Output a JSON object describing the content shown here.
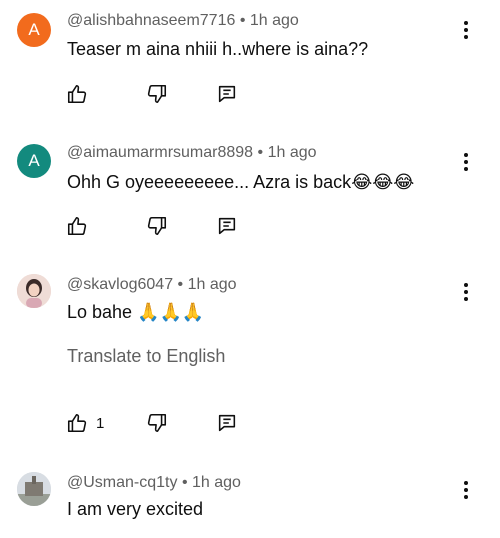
{
  "comments": [
    {
      "author": "@alishbahnaseem7716",
      "time": "1h ago",
      "avatar_letter": "A",
      "avatar_color": "#f26b1d",
      "text": "Teaser m aina nhiii h..where is aina??",
      "likes": ""
    },
    {
      "author": "@aimaumarmrsumar8898",
      "time": "1h ago",
      "avatar_letter": "A",
      "avatar_color": "#138a7e",
      "text": "Ohh G oyeeeeeeeee... Azra is back",
      "emoji": "😂😂😂",
      "likes": ""
    },
    {
      "author": "@skavlog6047",
      "time": "1h ago",
      "avatar_letter": "",
      "avatar_color": "#e8c7c0",
      "text": "Lo bahe ",
      "emoji": "🙏🙏🙏",
      "translate": "Translate to English",
      "likes": "1"
    },
    {
      "author": "@Usman-cq1ty",
      "time": "1h ago",
      "avatar_letter": "",
      "avatar_color": "#c9cfd6",
      "text": "I am very excited",
      "likes": ""
    }
  ],
  "separator": "•",
  "icons": {
    "like": "thumbs-up-icon",
    "dislike": "thumbs-down-icon",
    "reply": "reply-icon",
    "more": "more-vert-icon"
  }
}
